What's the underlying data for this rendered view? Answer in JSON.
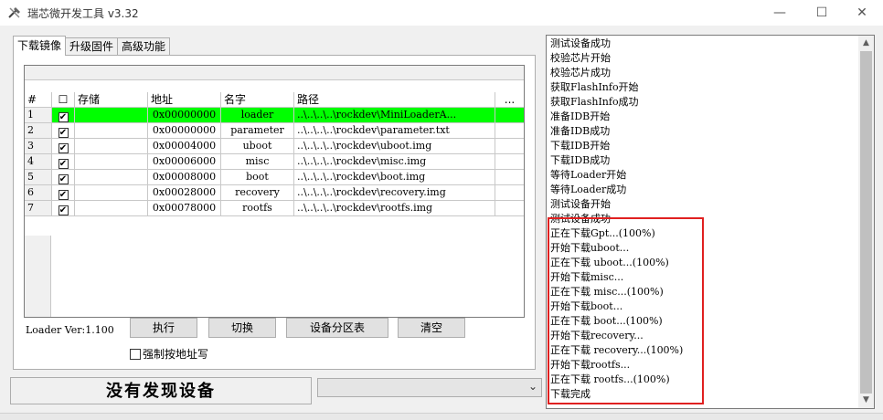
{
  "window": {
    "title": "瑞芯微开发工具 v3.32",
    "controls": {
      "minimize": "—",
      "maximize": "☐",
      "close": "✕"
    }
  },
  "tabs": [
    {
      "label": "下载镜像",
      "active": true
    },
    {
      "label": "升级固件",
      "active": false
    },
    {
      "label": "高级功能",
      "active": false
    }
  ],
  "table": {
    "columns": [
      "#",
      "☐",
      "存储",
      "地址",
      "名字",
      "路径",
      "..."
    ],
    "rows": [
      {
        "num": "1",
        "checked": "✔",
        "storage": "",
        "address": "0x00000000",
        "name": "loader",
        "path": "..\\..\\..\\..\\rockdev\\MiniLoaderA...",
        "highlighted": true
      },
      {
        "num": "2",
        "checked": "✔",
        "storage": "",
        "address": "0x00000000",
        "name": "parameter",
        "path": "..\\..\\..\\..\\rockdev\\parameter.txt",
        "highlighted": false
      },
      {
        "num": "3",
        "checked": "✔",
        "storage": "",
        "address": "0x00004000",
        "name": "uboot",
        "path": "..\\..\\..\\..\\rockdev\\uboot.img",
        "highlighted": false
      },
      {
        "num": "4",
        "checked": "✔",
        "storage": "",
        "address": "0x00006000",
        "name": "misc",
        "path": "..\\..\\..\\..\\rockdev\\misc.img",
        "highlighted": false
      },
      {
        "num": "5",
        "checked": "✔",
        "storage": "",
        "address": "0x00008000",
        "name": "boot",
        "path": "..\\..\\..\\..\\rockdev\\boot.img",
        "highlighted": false
      },
      {
        "num": "6",
        "checked": "✔",
        "storage": "",
        "address": "0x00028000",
        "name": "recovery",
        "path": "..\\..\\..\\..\\rockdev\\recovery.img",
        "highlighted": false
      },
      {
        "num": "7",
        "checked": "✔",
        "storage": "",
        "address": "0x00078000",
        "name": "rootfs",
        "path": "..\\..\\..\\..\\rockdev\\rootfs.img",
        "highlighted": false
      }
    ]
  },
  "loader_version": "Loader Ver:1.100",
  "buttons": {
    "run": "执行",
    "switch": "切换",
    "partition_table": "设备分区表",
    "clear": "清空"
  },
  "force_address_write": "强制按地址写",
  "status_text": "没有发现设备",
  "device_select_value": "",
  "log_lines": [
    "测试设备成功",
    "校验芯片开始",
    "校验芯片成功",
    "获取FlashInfo开始",
    "获取FlashInfo成功",
    "准备IDB开始",
    "准备IDB成功",
    "下载IDB开始",
    "下载IDB成功",
    "等待Loader开始",
    "等待Loader成功",
    "测试设备开始",
    "测试设备成功",
    "正在下载Gpt...(100%)",
    "开始下载uboot...",
    "正在下载 uboot...(100%)",
    "开始下载misc...",
    "正在下载 misc...(100%)",
    "开始下载boot...",
    "正在下载 boot...(100%)",
    "开始下载recovery...",
    "正在下载 recovery...(100%)",
    "开始下载rootfs...",
    "正在下载 rootfs...(100%)",
    "下载完成"
  ],
  "colors": {
    "highlight_row": "#00ff00",
    "annotation_box": "#e02020"
  }
}
